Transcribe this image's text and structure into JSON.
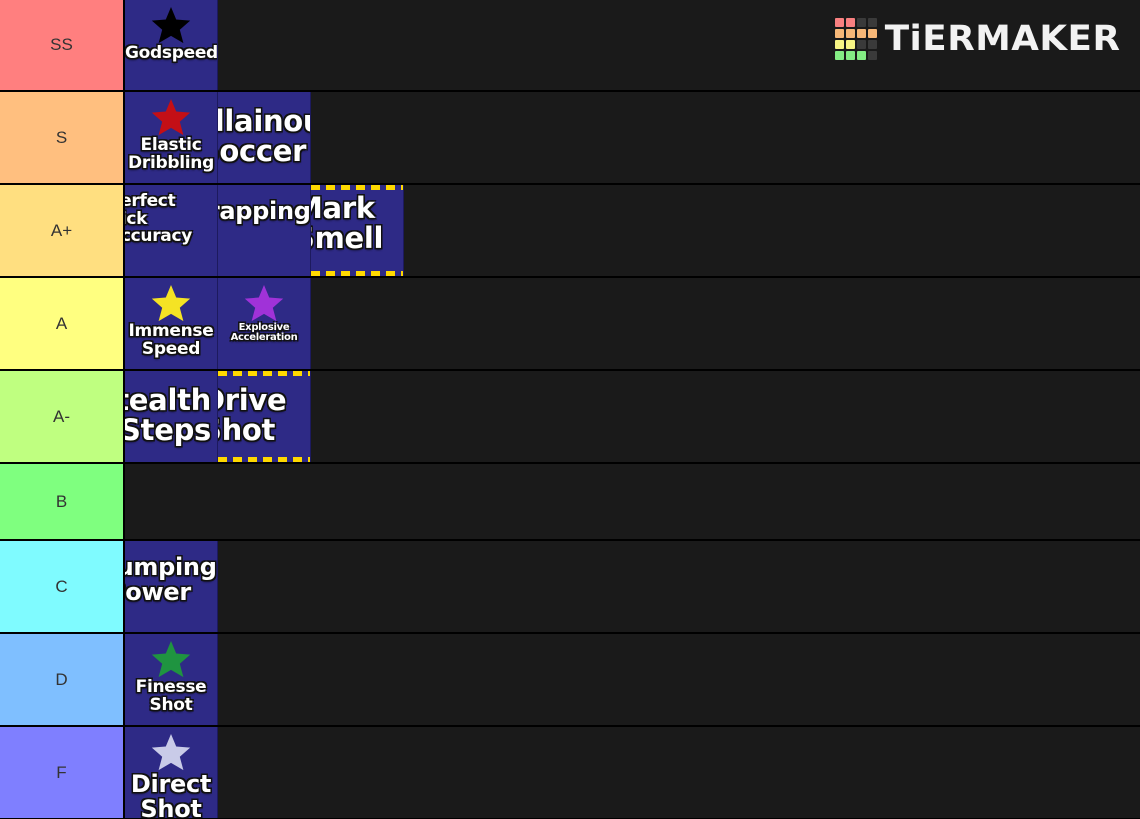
{
  "logo": {
    "wordmark": "TiERMAKER",
    "grid_colors": [
      [
        "#f98080",
        "#f98080",
        "#3a3a3a",
        "#3a3a3a"
      ],
      [
        "#f8b878",
        "#f8b878",
        "#f8b878",
        "#f8b878"
      ],
      [
        "#f7f584",
        "#f7f584",
        "#3a3a3a",
        "#3a3a3a"
      ],
      [
        "#84ee84",
        "#84ee84",
        "#84ee84",
        "#3a3a3a"
      ]
    ]
  },
  "tiers": [
    {
      "label": "SS",
      "color": "#ff7f7f",
      "height": 92,
      "items": [
        {
          "name": "Godspeed",
          "star": "#000000",
          "lines": [
            "Godspeed"
          ],
          "size": "t-md",
          "clip": "none",
          "dashed": false,
          "pad": "pad-top-sm"
        }
      ]
    },
    {
      "label": "S",
      "color": "#ffbf7f",
      "height": 93,
      "items": [
        {
          "name": "Elastic Dribbling",
          "star": "#c40f16",
          "lines": [
            "Elastic",
            "Dribbling"
          ],
          "size": "t-md",
          "clip": "none",
          "dashed": false,
          "pad": "pad-top-sm"
        },
        {
          "name": "Villainous Soccer",
          "star": null,
          "lines": [
            "Villainous",
            "Soccer"
          ],
          "size": "t-xl",
          "clip": "overflow-wide",
          "dashed": false,
          "pad": "pad-top-md"
        }
      ]
    },
    {
      "label": "A+",
      "color": "#ffdf80",
      "height": 93,
      "items": [
        {
          "name": "Perfect Kick Accuracy",
          "star": null,
          "lines": [
            "Perfect",
            "Kick",
            "Accuracy"
          ],
          "size": "t-md",
          "clip": "overflow-right",
          "dashed": false,
          "pad": "pad-top-sm"
        },
        {
          "name": "Trapping",
          "star": null,
          "lines": [
            "Trapping"
          ],
          "size": "t-lg",
          "clip": "overflow-wide",
          "dashed": false,
          "pad": "pad-top-md"
        },
        {
          "name": "Mark Smell",
          "star": null,
          "lines": [
            "Mark",
            "Smell"
          ],
          "size": "t-xl",
          "clip": "overflow-right",
          "dashed": true,
          "pad": "pad-top-sm"
        }
      ]
    },
    {
      "label": "A",
      "color": "#ffff80",
      "height": 93,
      "items": [
        {
          "name": "Immense Speed",
          "star": "#f5e324",
          "lines": [
            "Immense",
            "Speed"
          ],
          "size": "t-md",
          "clip": "none",
          "dashed": false,
          "pad": "pad-top-sm"
        },
        {
          "name": "Explosive Acceleration",
          "star": "#a032d8",
          "lines": [
            "Explosive",
            "Acceleration"
          ],
          "size": "t-xxs",
          "clip": "none",
          "dashed": false,
          "pad": "pad-top-sm"
        }
      ]
    },
    {
      "label": "A-",
      "color": "#bfff80",
      "height": 93,
      "items": [
        {
          "name": "Stealth Steps",
          "star": null,
          "lines": [
            "Stealth",
            "Steps"
          ],
          "size": "t-xl",
          "clip": "overflow-left",
          "dashed": false,
          "pad": "pad-top-md"
        },
        {
          "name": "Drive Shot",
          "star": null,
          "lines": [
            "Drive",
            "Shot"
          ],
          "size": "t-xl",
          "clip": "overflow-right",
          "dashed": true,
          "pad": "pad-top-md"
        }
      ]
    },
    {
      "label": "B",
      "color": "#7fff7f",
      "height": 77,
      "items": []
    },
    {
      "label": "C",
      "color": "#7ffbff",
      "height": 93,
      "items": [
        {
          "name": "Jumping Power",
          "star": null,
          "lines": [
            "Jumping",
            "Power"
          ],
          "size": "t-lg",
          "clip": "overflow-right",
          "dashed": false,
          "pad": "pad-top-md"
        }
      ]
    },
    {
      "label": "D",
      "color": "#7fbfff",
      "height": 93,
      "items": [
        {
          "name": "Finesse Shot",
          "star": "#1f9440",
          "lines": [
            "Finesse",
            "Shot"
          ],
          "size": "t-md",
          "clip": "none",
          "dashed": false,
          "pad": "pad-top-sm"
        }
      ]
    },
    {
      "label": "F",
      "color": "#7f7fff",
      "height": 93,
      "items": [
        {
          "name": "Direct Shot",
          "star": "#c9cbe8",
          "lines": [
            "Direct",
            "Shot"
          ],
          "size": "t-lg",
          "clip": "none",
          "dashed": false,
          "pad": "pad-top-sm"
        }
      ]
    }
  ]
}
